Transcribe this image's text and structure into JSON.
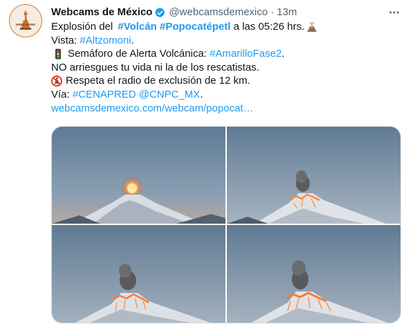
{
  "author": {
    "name": "Webcams de México",
    "handle": "@webcamsdemexico",
    "separator": "·",
    "time": "13m",
    "avatar_text": "WEBCAMSMX"
  },
  "tweet": {
    "line1": {
      "pre": "Explosión del ",
      "tag1": "#Volcán",
      "tag2": "#Popocatépetl",
      "post": " a las 05:26 hrs."
    },
    "line2": {
      "pre": "Vista: ",
      "tag": "#Altzomoni",
      "post": "."
    },
    "line3": {
      "pre": "Semáforo de Alerta Volcánica: ",
      "tag": "#AmarilloFase2",
      "post": "."
    },
    "line4": "NO arriesgues tu vida ni la de los rescatistas.",
    "line5": "Respeta el radio de exclusión de 12 km.",
    "line6": {
      "pre": "Vía: ",
      "mention1": "#CENAPRED",
      "space": " ",
      "mention2": "@CNPC_MX",
      "post": "."
    },
    "line7": "webcamsdemexico.com/webcam/popocat…"
  },
  "icons": {
    "verified": "verified-badge-icon",
    "more": "more-options-icon",
    "volcano": "volcano-emoji-icon",
    "traffic_light": "traffic-light-emoji-icon",
    "no_pedestrians": "no-pedestrians-emoji-icon"
  },
  "colors": {
    "link": "#1d9bf0",
    "text": "#0f1419",
    "secondary": "#536471",
    "border": "#cfd9de"
  }
}
